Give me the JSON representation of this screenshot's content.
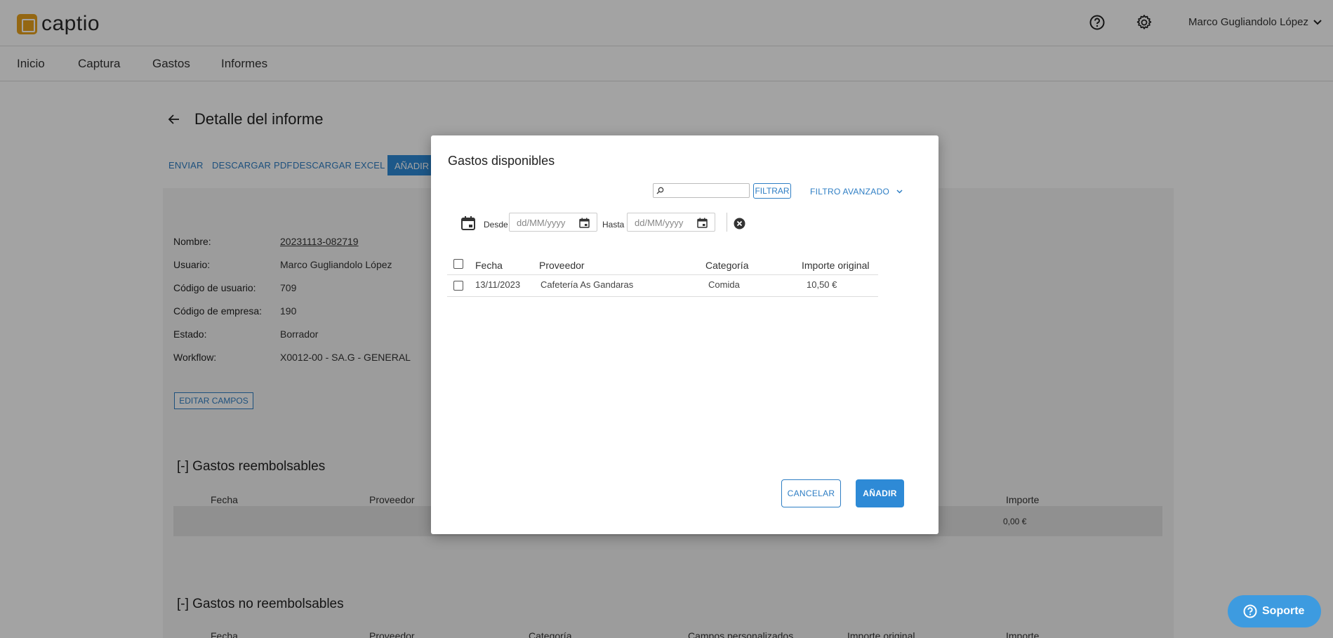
{
  "app": {
    "logo_text": "captio",
    "brand_color": "#e8a21d"
  },
  "header": {
    "user_name": "Marco Gugliandolo López"
  },
  "nav": {
    "items": [
      "Inicio",
      "Captura",
      "Gastos",
      "Informes"
    ]
  },
  "page": {
    "title": "Detalle del informe",
    "actions": [
      "ENVIAR",
      "DESCARGAR PDF",
      "DESCARGAR EXCEL"
    ],
    "add_expense_label": "AÑADIR GASTOS",
    "fields": [
      {
        "label": "Nombre:",
        "value": "20231113-082719"
      },
      {
        "label": "Usuario:",
        "value": "Marco Gugliandolo López"
      },
      {
        "label": "Código de usuario:",
        "value": "709"
      },
      {
        "label": "Código de empresa:",
        "value": "190"
      },
      {
        "label": "Estado:",
        "value": "Borrador"
      },
      {
        "label": "Workflow:",
        "value": "X0012-00 - SA.G - GENERAL"
      }
    ],
    "edit_fields_label": "EDITAR CAMPOS",
    "reimbursable": {
      "title": "[-] Gastos reembolsables",
      "columns": [
        "Fecha",
        "Proveedor",
        "Importe"
      ],
      "total": "0,00 €"
    },
    "non_reimbursable": {
      "title": "[-] Gastos no reembolsables",
      "columns": [
        "Fecha",
        "Proveedor",
        "Categoría",
        "Campos personalizados",
        "Importe original",
        "Importe"
      ]
    }
  },
  "modal": {
    "title": "Gastos disponibles",
    "search_placeholder": "",
    "filter_label": "FILTRAR",
    "advanced_filter_label": "FILTRO AVANZADO",
    "from_label": "Desde",
    "to_label": "Hasta",
    "from_placeholder": "dd/MM/yyyy",
    "to_placeholder": "dd/MM/yyyy",
    "columns": {
      "date": "Fecha",
      "provider": "Proveedor",
      "category": "Categoría",
      "amount": "Importe original"
    },
    "rows": [
      {
        "date": "13/11/2023",
        "provider": "Cafetería As Gandaras",
        "category": "Comida",
        "amount": "10,50 €"
      }
    ],
    "cancel_label": "CANCELAR",
    "add_label": "AÑADIR"
  },
  "support": {
    "label": "Soporte"
  },
  "colors": {
    "accent": "#2e8ad6",
    "link": "#2e7ec4",
    "support": "#3d9be0"
  }
}
